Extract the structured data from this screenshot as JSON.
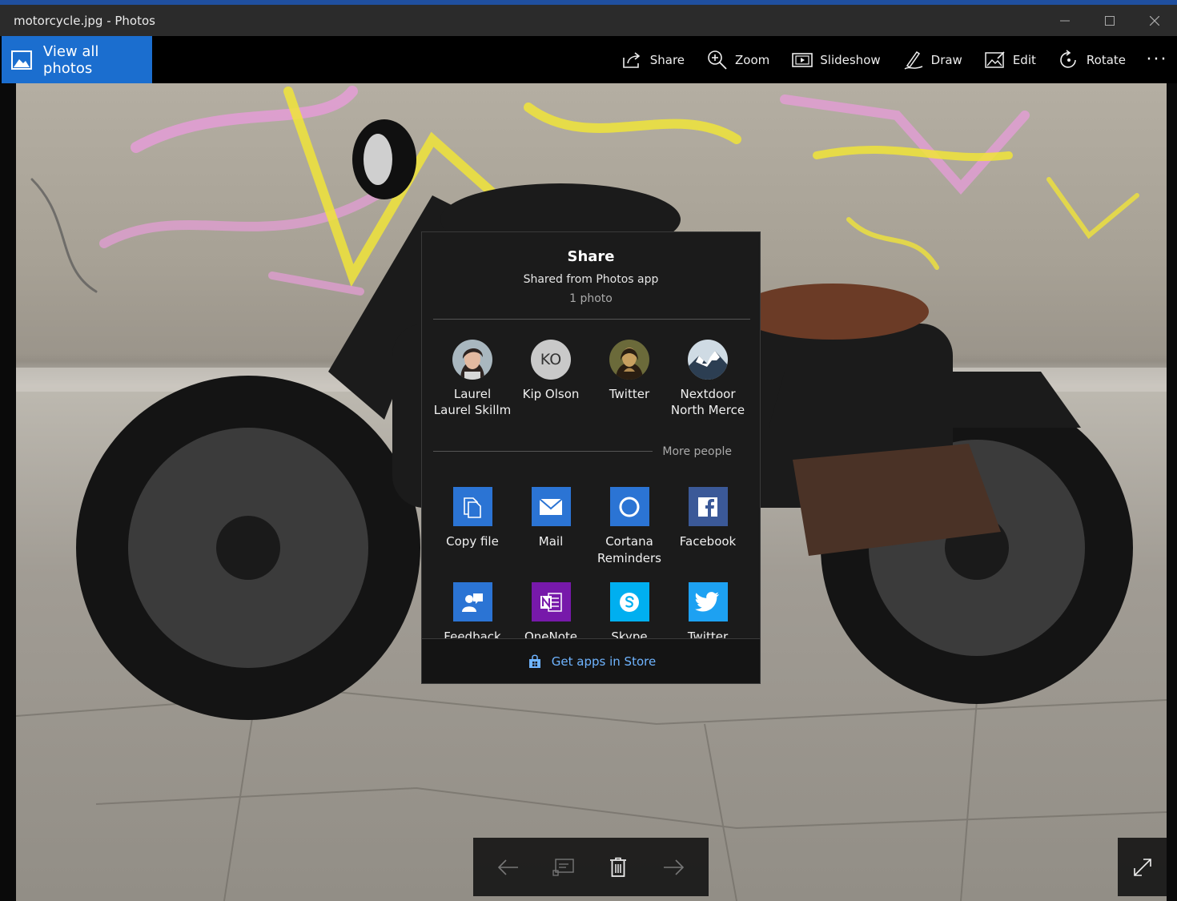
{
  "window": {
    "title": "motorcycle.jpg - Photos"
  },
  "commandbar": {
    "view_all_label": "View all photos",
    "commands": {
      "share": "Share",
      "zoom": "Zoom",
      "slideshow": "Slideshow",
      "draw": "Draw",
      "edit": "Edit",
      "rotate": "Rotate"
    },
    "more": "···"
  },
  "share_panel": {
    "title": "Share",
    "subtitle": "Shared from Photos app",
    "count": "1 photo",
    "people": [
      {
        "name_line1": "Laurel",
        "name_line2": "Laurel Skillm",
        "avatar": "photo-woman"
      },
      {
        "name_line1": "Kip Olson",
        "name_line2": "",
        "initials": "KO"
      },
      {
        "name_line1": "Twitter",
        "name_line2": "",
        "avatar": "photo-monalisa"
      },
      {
        "name_line1": "Nextdoor",
        "name_line2": "North Merce",
        "avatar": "photo-mountain"
      }
    ],
    "more_people": "More people",
    "apps_row1": [
      {
        "name_line1": "Copy file",
        "name_line2": "",
        "icon": "copy-file-icon",
        "color": "#2b74d4"
      },
      {
        "name_line1": "Mail",
        "name_line2": "",
        "icon": "mail-icon",
        "color": "#2b74d4"
      },
      {
        "name_line1": "Cortana",
        "name_line2": "Reminders",
        "icon": "cortana-icon",
        "color": "#2b74d4"
      },
      {
        "name_line1": "Facebook",
        "name_line2": "",
        "icon": "facebook-icon",
        "color": "#3b5998"
      }
    ],
    "apps_row2": [
      {
        "name_line1": "Feedback",
        "icon": "feedback-icon",
        "color": "#2b74d4"
      },
      {
        "name_line1": "OneNote",
        "icon": "onenote-icon",
        "color": "#7719aa"
      },
      {
        "name_line1": "Skype",
        "icon": "skype-icon",
        "color": "#00aff0"
      },
      {
        "name_line1": "Twitter",
        "icon": "twitter-icon",
        "color": "#1da1f2"
      }
    ],
    "store_link": "Get apps in Store"
  }
}
